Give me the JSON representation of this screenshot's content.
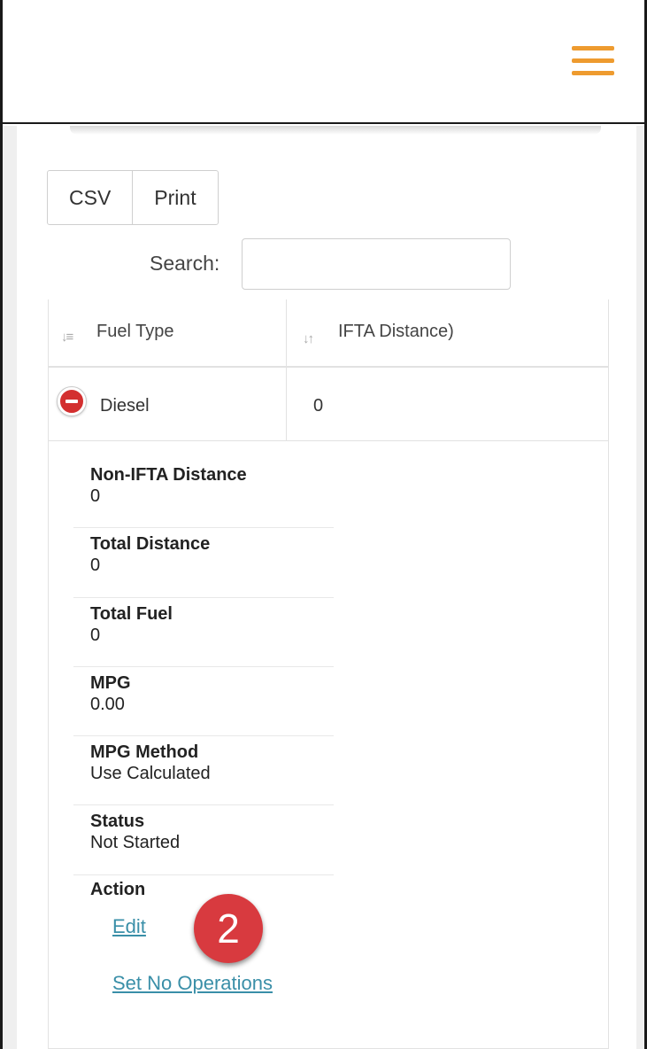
{
  "header": {
    "menu_icon": "hamburger-menu-icon",
    "accent_color": "#ee9b2f"
  },
  "toolbar": {
    "csv_label": "CSV",
    "print_label": "Print"
  },
  "search": {
    "label": "Search:",
    "value": "",
    "placeholder": ""
  },
  "table": {
    "columns": [
      {
        "label": "Fuel Type",
        "sort_icon": "sort-asc-icon"
      },
      {
        "label": "IFTA Distance)",
        "sort_icon": "sort-icon"
      }
    ],
    "rows": [
      {
        "fuel_type": "Diesel",
        "ifta_distance": "0",
        "expanded": true
      }
    ]
  },
  "details": [
    {
      "title": "Non-IFTA Distance",
      "value": "0"
    },
    {
      "title": "Total Distance",
      "value": "0"
    },
    {
      "title": "Total Fuel",
      "value": "0"
    },
    {
      "title": "MPG",
      "value": "0.00"
    },
    {
      "title": "MPG Method",
      "value": "Use Calculated"
    },
    {
      "title": "Status",
      "value": "Not Started"
    }
  ],
  "action": {
    "title": "Action",
    "edit_label": "Edit",
    "no_ops_label": "Set No Operations"
  },
  "annotation": {
    "step_number": "2",
    "color": "#d83a3f"
  }
}
